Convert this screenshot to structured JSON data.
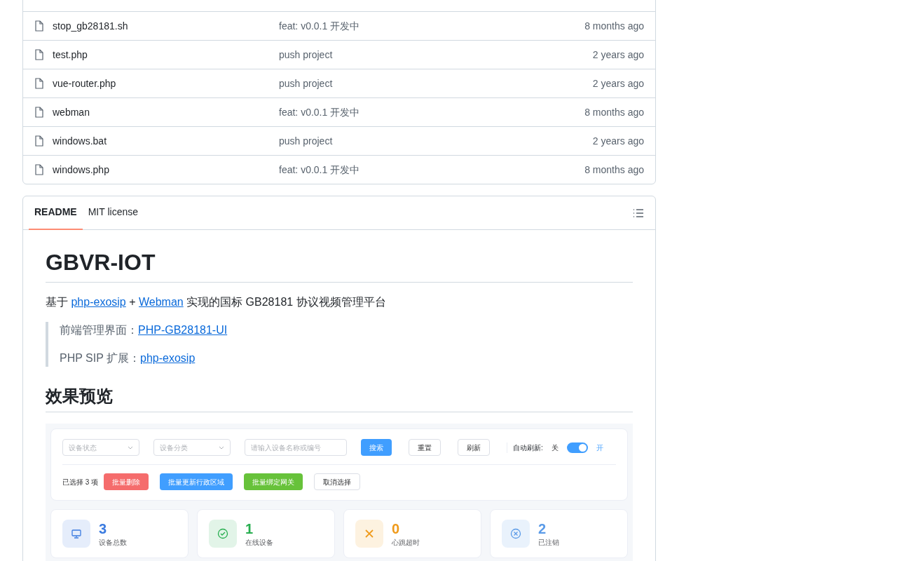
{
  "files": [
    {
      "name": "stop_gb28181.sh",
      "commit": "feat: v0.0.1 开发中",
      "time": "8 months ago"
    },
    {
      "name": "test.php",
      "commit": "push project",
      "time": "2 years ago"
    },
    {
      "name": "vue-router.php",
      "commit": "push project",
      "time": "2 years ago"
    },
    {
      "name": "webman",
      "commit": "feat: v0.0.1 开发中",
      "time": "8 months ago"
    },
    {
      "name": "windows.bat",
      "commit": "push project",
      "time": "2 years ago"
    },
    {
      "name": "windows.php",
      "commit": "feat: v0.0.1 开发中",
      "time": "8 months ago"
    }
  ],
  "readme": {
    "tabs": [
      {
        "label": "README",
        "selected": true
      },
      {
        "label": "MIT license",
        "selected": false
      }
    ],
    "title": "GBVR-IOT",
    "intro": [
      {
        "kind": "text",
        "text": "基于 "
      },
      {
        "kind": "link",
        "text": "php-exosip"
      },
      {
        "kind": "text",
        "text": " + "
      },
      {
        "kind": "link",
        "text": "Webman"
      },
      {
        "kind": "text",
        "text": " 实现的国标 GB28181 协议视频管理平台"
      }
    ],
    "quotes": [
      {
        "label": "前端管理界面：",
        "link": "PHP-GB28181-UI"
      },
      {
        "label": "PHP SIP 扩展：",
        "link": "php-exosip"
      }
    ],
    "section_heading": "效果预览",
    "preview": {
      "filters": [
        {
          "kind": "select",
          "placeholder": "设备状态"
        },
        {
          "kind": "select",
          "placeholder": "设备分类"
        },
        {
          "kind": "input",
          "placeholder": "请输入设备名称或编号"
        }
      ],
      "buttons": [
        {
          "label": "搜索",
          "kind": "primary"
        },
        {
          "label": "重置",
          "kind": "default"
        },
        {
          "label": "刷新",
          "kind": "default"
        }
      ],
      "auto_refresh": {
        "label": "自动刷新:",
        "off_label": "关",
        "on_label": "开",
        "on": true
      },
      "selection_text": "已选择 3 项",
      "batch_buttons": [
        {
          "label": "批量删除",
          "color": "#f56c6c"
        },
        {
          "label": "批量更新行政区域",
          "color": "#409eff"
        },
        {
          "label": "批量绑定网关",
          "color": "#67c23a"
        },
        {
          "label": "取消选择",
          "color": "#ffffff"
        }
      ],
      "stats": [
        {
          "value": "3",
          "label": "设备总数",
          "color": "#3b7be0",
          "kind": "monitor"
        },
        {
          "value": "1",
          "label": "在线设备",
          "color": "#27ae4f",
          "kind": "check"
        },
        {
          "value": "0",
          "label": "心跳超时",
          "color": "#ef9a1a",
          "kind": "x"
        },
        {
          "value": "2",
          "label": "已注销",
          "color": "#5b9be8",
          "kind": "x-circle"
        }
      ]
    }
  }
}
